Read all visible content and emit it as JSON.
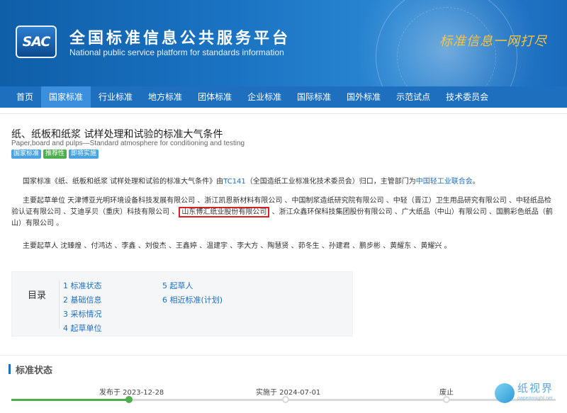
{
  "header": {
    "logo_text": "SAC",
    "title": "全国标准信息公共服务平台",
    "subtitle": "National public service platform  for standards information",
    "slogan": "标准信息一网打尽"
  },
  "nav": {
    "items": [
      {
        "label": "首页"
      },
      {
        "label": "国家标准"
      },
      {
        "label": "行业标准"
      },
      {
        "label": "地方标准"
      },
      {
        "label": "团体标准"
      },
      {
        "label": "企业标准"
      },
      {
        "label": "国际标准"
      },
      {
        "label": "国外标准"
      },
      {
        "label": "示范试点"
      },
      {
        "label": "技术委员会"
      }
    ],
    "active_index": 1
  },
  "standard": {
    "title": "纸、纸板和纸浆 试样处理和试验的标准大气条件",
    "title_en": "Paper,board and pulps—Standard atmosphere for conditioning and testing",
    "tags": [
      "国家标准",
      "推荐性",
      "即将实施"
    ]
  },
  "description": {
    "p1_prefix": "国家标准《纸、纸板和纸浆 试样处理和试验的标准大气条件》由",
    "p1_tc": "TC141",
    "p1_mid": "（全国造纸工业标准化技术委员会）归口，主管部门为",
    "p1_dept": "中国轻工业联合会",
    "p1_suffix": "。",
    "p2_prefix": "主要起草单位 天津博亚光明环境设备科技发展有限公司 、浙江凯恩新材料有限公司 、中国制浆造纸研究院有限公司 、中轻（晋江）卫生用品研究有限公司 、中轻纸品检验认证有限公司 、艾迪孚贝（重庆）科技有限公司 、",
    "p2_highlight": "山东博汇纸业股份有限公司",
    "p2_suffix": " 、浙江众鑫环保科技集团股份有限公司 、广大纸品（中山）有限公司 、国鹏彩色纸品（鹤山）有限公司 。",
    "p3": "主要起草人 沈臻煌 、付鸿达 、李鑫 、刘俊杰 、王鑫婷 、温建宇 、李大方 、陶慧贤 、茆冬生 、孙建君 、鹏步彬 、黄耀东 、黄耀兴 。"
  },
  "toc": {
    "label": "目录",
    "col1": [
      "1  标准状态",
      "2  基础信息",
      "3  采标情况",
      "4  起草单位"
    ],
    "col2": [
      "5  起草人",
      "6  相近标准(计划)"
    ]
  },
  "status_section": {
    "title": "标准状态",
    "timeline": [
      {
        "label": "发布于 2023-12-28",
        "done": true
      },
      {
        "label": "实施于 2024-07-01",
        "done": false
      },
      {
        "label": "废止",
        "done": false
      }
    ]
  },
  "watermark": {
    "text": "纸视界",
    "url": "paperinsight.net"
  },
  "colors": {
    "brand_blue": "#1f6fbf",
    "active_nav": "#3b8fdd",
    "done_green": "#4cae4c",
    "highlight_red": "#e02020"
  }
}
